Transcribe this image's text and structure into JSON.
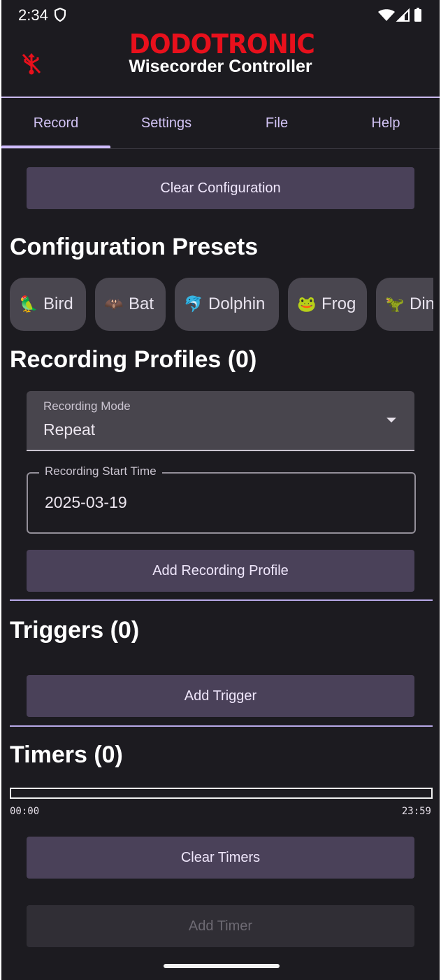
{
  "status_bar": {
    "time": "2:34"
  },
  "header": {
    "brand": "DODOTRONIC",
    "title": "Wisecorder Controller",
    "brand_color": "#e8101c"
  },
  "tabs": [
    {
      "label": "Record",
      "active": true
    },
    {
      "label": "Settings",
      "active": false
    },
    {
      "label": "File",
      "active": false
    },
    {
      "label": "Help",
      "active": false
    }
  ],
  "buttons": {
    "clear_configuration": "Clear Configuration",
    "add_recording_profile": "Add Recording Profile",
    "add_trigger": "Add Trigger",
    "clear_timers": "Clear Timers",
    "add_timer": "Add Timer"
  },
  "presets": {
    "title": "Configuration Presets",
    "items": [
      {
        "emoji": "🦜",
        "label": "Bird"
      },
      {
        "emoji": "🦇",
        "label": "Bat"
      },
      {
        "emoji": "🐬",
        "label": "Dolphin"
      },
      {
        "emoji": "🐸",
        "label": "Frog"
      },
      {
        "emoji": "🦖",
        "label": "Dinosaur"
      }
    ]
  },
  "recording_profiles": {
    "title": "Recording Profiles (0)",
    "mode_label": "Recording Mode",
    "mode_value": "Repeat",
    "start_time_label": "Recording Start Time",
    "start_time_value": "2025-03-19"
  },
  "triggers": {
    "title": "Triggers (0)"
  },
  "timers": {
    "title": "Timers (0)",
    "range_start": "00:00",
    "range_end": "23:59"
  },
  "colors": {
    "background": "#1c1b20",
    "accent": "#cfbcff",
    "button": "#4a4159"
  }
}
